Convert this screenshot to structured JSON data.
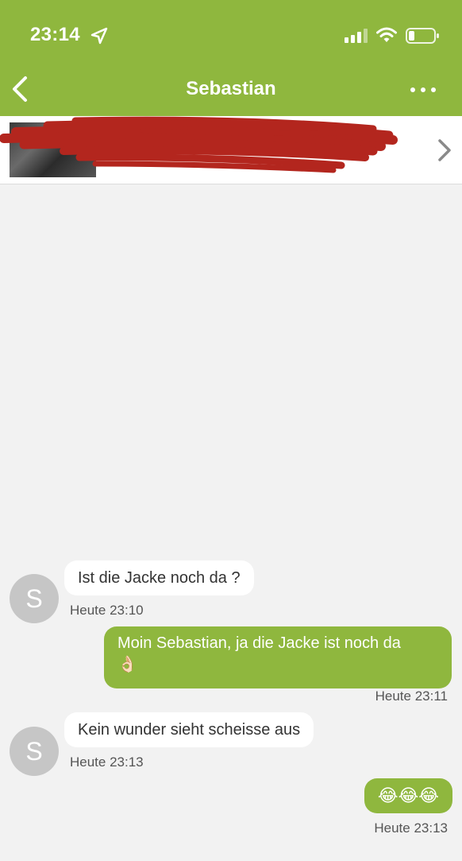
{
  "status_bar": {
    "time": "23:14",
    "icons": [
      "location-arrow-icon",
      "signal-icon",
      "wifi-icon",
      "battery-icon"
    ]
  },
  "nav": {
    "title": "Sebastian",
    "back_icon": "chevron-left-icon",
    "more_icon": "more-horizontal-icon"
  },
  "product": {
    "title": "",
    "subtitle": "",
    "redacted": true,
    "chevron_icon": "chevron-right-icon"
  },
  "messages": [
    {
      "direction": "incoming",
      "avatar_initial": "S",
      "text": "Ist die Jacke noch da ?",
      "timestamp": "Heute 23:10"
    },
    {
      "direction": "outgoing",
      "text": "Moin Sebastian, ja die Jacke ist noch da",
      "emoji": "👌🏻",
      "timestamp": "Heute 23:11"
    },
    {
      "direction": "incoming",
      "avatar_initial": "S",
      "text": "Kein wunder sieht scheisse aus",
      "timestamp": "Heute 23:13"
    },
    {
      "direction": "outgoing",
      "text": "😂😂😂",
      "timestamp": "Heute 23:13"
    }
  ],
  "colors": {
    "brand_green": "#8fb73e",
    "chat_background": "#f2f2f2",
    "incoming_bubble": "#ffffff",
    "avatar_gray": "#c6c6c6",
    "redaction_red": "#b3261e"
  }
}
